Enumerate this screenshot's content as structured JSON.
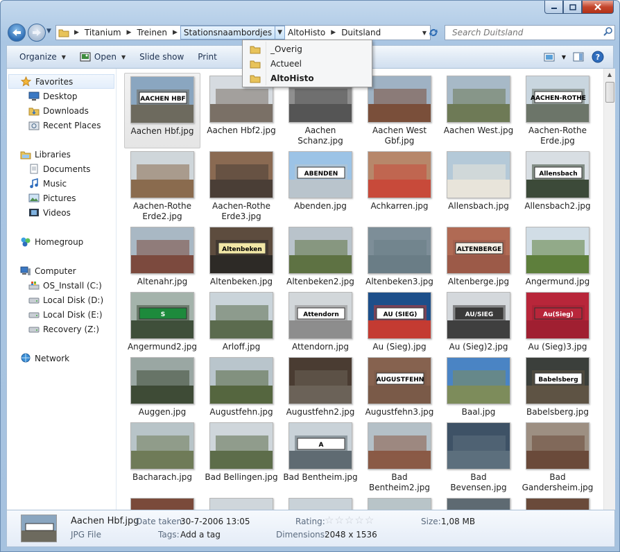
{
  "window": {
    "caption_buttons": [
      "minimize",
      "maximize",
      "close"
    ]
  },
  "address": {
    "breadcrumbs": [
      "Titanium",
      "Treinen",
      "Stationsnaambordjes",
      "AltoHisto",
      "Duitsland"
    ]
  },
  "search": {
    "placeholder": "Search Duitsland"
  },
  "breadcrumb_popup": {
    "items": [
      {
        "label": "_Overig",
        "bold": false
      },
      {
        "label": "Actueel",
        "bold": false
      },
      {
        "label": "AltoHisto",
        "bold": true
      }
    ]
  },
  "toolbar": {
    "organize": "Organize",
    "open": "Open",
    "slideshow": "Slide show",
    "print": "Print"
  },
  "sidebar": {
    "favorites": "Favorites",
    "desktop": "Desktop",
    "downloads": "Downloads",
    "recent": "Recent Places",
    "libraries": "Libraries",
    "documents": "Documents",
    "music": "Music",
    "pictures": "Pictures",
    "videos": "Videos",
    "homegroup": "Homegroup",
    "computer": "Computer",
    "drive_c": "OS_Install (C:)",
    "drive_d": "Local Disk (D:)",
    "drive_e": "Local Disk (E:)",
    "drive_z": "Recovery (Z:)",
    "network": "Network"
  },
  "files": [
    {
      "name": "Aachen Hbf.jpg",
      "sign": "AACHEN HBF",
      "sky": "#8aa6c0",
      "ground": "#6d6a5e",
      "signbg": "#ffffff",
      "signfg": "#000000"
    },
    {
      "name": "Aachen Hbf2.jpg",
      "sign": "",
      "sky": "#d6dbe0",
      "ground": "#7a7066",
      "signbg": "#ffffff",
      "signfg": "#000000"
    },
    {
      "name": "Aachen Schanz.jpg",
      "sign": "",
      "sky": "#8f8f8f",
      "ground": "#555555",
      "signbg": "#c0392b",
      "signfg": "#ffffff"
    },
    {
      "name": "Aachen West Gbf.jpg",
      "sign": "",
      "sky": "#9fb2c4",
      "ground": "#7a4f3a",
      "signbg": "#ffffff",
      "signfg": "#000000"
    },
    {
      "name": "Aachen West.jpg",
      "sign": "",
      "sky": "#a7b9c7",
      "ground": "#6e7a56",
      "signbg": "#ffffff",
      "signfg": "#000000"
    },
    {
      "name": "Aachen-Rothe Erde.jpg",
      "sign": "AACHEN-ROTHE",
      "sky": "#c9d6df",
      "ground": "#6c7569",
      "signbg": "#ffffff",
      "signfg": "#000000"
    },
    {
      "name": "Aachen-Rothe Erde2.jpg",
      "sign": "",
      "sky": "#cfd6da",
      "ground": "#8a6b4e",
      "signbg": "#ffffff",
      "signfg": "#000000"
    },
    {
      "name": "Aachen-Rothe Erde3.jpg",
      "sign": "",
      "sky": "#8a6a52",
      "ground": "#4a3e36",
      "signbg": "#ffffff",
      "signfg": "#000000"
    },
    {
      "name": "Abenden.jpg",
      "sign": "ABENDEN",
      "sky": "#9cc3e6",
      "ground": "#b9c4cc",
      "signbg": "#ffffff",
      "signfg": "#000000"
    },
    {
      "name": "Achkarren.jpg",
      "sign": "",
      "sky": "#b7876a",
      "ground": "#c84a3a",
      "signbg": "#ffffff",
      "signfg": "#000000"
    },
    {
      "name": "Allensbach.jpg",
      "sign": "",
      "sky": "#b4c9d8",
      "ground": "#e8e4da",
      "signbg": "#ffffff",
      "signfg": "#000000"
    },
    {
      "name": "Allensbach2.jpg",
      "sign": "Allensbach",
      "sky": "#d8dee3",
      "ground": "#3c4a39",
      "signbg": "#ffffff",
      "signfg": "#000000"
    },
    {
      "name": "Altenahr.jpg",
      "sign": "",
      "sky": "#a9b8c4",
      "ground": "#7c4a3e",
      "signbg": "#ffffff",
      "signfg": "#000000"
    },
    {
      "name": "Altenbeken.jpg",
      "sign": "Altenbeken",
      "sky": "#5d4c3e",
      "ground": "#2d2a26",
      "signbg": "#f1e7a6",
      "signfg": "#000000"
    },
    {
      "name": "Altenbeken2.jpg",
      "sign": "",
      "sky": "#b9c3cb",
      "ground": "#5e7243",
      "signbg": "#ffffff",
      "signfg": "#000000"
    },
    {
      "name": "Altenbeken3.jpg",
      "sign": "",
      "sky": "#7d8e98",
      "ground": "#6a7d86",
      "signbg": "#ffffff",
      "signfg": "#000000"
    },
    {
      "name": "Altenberge.jpg",
      "sign": "ALTENBERGE",
      "sky": "#b06a54",
      "ground": "#9c5a48",
      "signbg": "#f5f0e6",
      "signfg": "#000000"
    },
    {
      "name": "Angermund.jpg",
      "sign": "",
      "sky": "#d1dde6",
      "ground": "#5e7f3c",
      "signbg": "#ffffff",
      "signfg": "#000000"
    },
    {
      "name": "Angermund2.jpg",
      "sign": "S",
      "sky": "#a4b3ab",
      "ground": "#3f4f3a",
      "signbg": "#1d8a3c",
      "signfg": "#ffffff"
    },
    {
      "name": "Arloff.jpg",
      "sign": "",
      "sky": "#cad4da",
      "ground": "#5b6b4e",
      "signbg": "#d43a2f",
      "signfg": "#ffffff"
    },
    {
      "name": "Attendorn.jpg",
      "sign": "Attendorn",
      "sky": "#d2d7da",
      "ground": "#8d8d8d",
      "signbg": "#ffffff",
      "signfg": "#000000"
    },
    {
      "name": "Au (Sieg).jpg",
      "sign": "AU (SIEG)",
      "sky": "#1d4f8a",
      "ground": "#c43b32",
      "signbg": "#ffffff",
      "signfg": "#000000"
    },
    {
      "name": "Au (Sieg)2.jpg",
      "sign": "AU/SIEG",
      "sky": "#d4d8dc",
      "ground": "#3f3f3f",
      "signbg": "#3a3a3a",
      "signfg": "#ffffff"
    },
    {
      "name": "Au (Sieg)3.jpg",
      "sign": "Au(Sieg)",
      "sky": "#b8263a",
      "ground": "#a01f31",
      "signbg": "#b8263a",
      "signfg": "#ffffff"
    },
    {
      "name": "Auggen.jpg",
      "sign": "",
      "sky": "#9aa7a3",
      "ground": "#3e4b36",
      "signbg": "#ffffff",
      "signfg": "#000000"
    },
    {
      "name": "Augustfehn.jpg",
      "sign": "",
      "sky": "#b9c5cc",
      "ground": "#55663f",
      "signbg": "#ffffff",
      "signfg": "#000000"
    },
    {
      "name": "Augustfehn2.jpg",
      "sign": "",
      "sky": "#4a3c32",
      "ground": "#6b6258",
      "signbg": "#ffffff",
      "signfg": "#000000"
    },
    {
      "name": "Augustfehn3.jpg",
      "sign": "AUGUSTFEHN",
      "sky": "#86624f",
      "ground": "#7a5a48",
      "signbg": "#ffffff",
      "signfg": "#000000"
    },
    {
      "name": "Baal.jpg",
      "sign": "",
      "sky": "#4a84c4",
      "ground": "#7d8c5b",
      "signbg": "#ffffff",
      "signfg": "#000000"
    },
    {
      "name": "Babelsberg.jpg",
      "sign": "Babelsberg",
      "sky": "#3b3f3b",
      "ground": "#5e5344",
      "signbg": "#ffffff",
      "signfg": "#000000"
    },
    {
      "name": "Bacharach.jpg",
      "sign": "",
      "sky": "#b8c4c8",
      "ground": "#6f7b58",
      "signbg": "#ffffff",
      "signfg": "#000000"
    },
    {
      "name": "Bad Bellingen.jpg",
      "sign": "",
      "sky": "#cfd6db",
      "ground": "#5d6d4a",
      "signbg": "#ffffff",
      "signfg": "#000000"
    },
    {
      "name": "Bad Bentheim.jpg",
      "sign": "A",
      "sky": "#c9d2d8",
      "ground": "#5f6b72",
      "signbg": "#ffffff",
      "signfg": "#000000"
    },
    {
      "name": "Bad Bentheim2.jpg",
      "sign": "",
      "sky": "#b4c0c7",
      "ground": "#8a5a46",
      "signbg": "#ffffff",
      "signfg": "#000000"
    },
    {
      "name": "Bad Bevensen.jpg",
      "sign": "",
      "sky": "#3e5266",
      "ground": "#5c6f7d",
      "signbg": "#ffffff",
      "signfg": "#000000"
    },
    {
      "name": "Bad Gandersheim.jpg",
      "sign": "",
      "sky": "#9d8f82",
      "ground": "#6a4a3a",
      "signbg": "#ffffff",
      "signfg": "#000000"
    }
  ],
  "details": {
    "filename": "Aachen Hbf.jpg",
    "filetype": "JPG File",
    "date_label": "Date taken:",
    "date_value": "30-7-2006 13:05",
    "tags_label": "Tags:",
    "tags_value": "Add a tag",
    "rating_label": "Rating:",
    "rating_value": 0,
    "dimensions_label": "Dimensions:",
    "dimensions_value": "2048 x 1536",
    "size_label": "Size:",
    "size_value": "1,08 MB"
  }
}
